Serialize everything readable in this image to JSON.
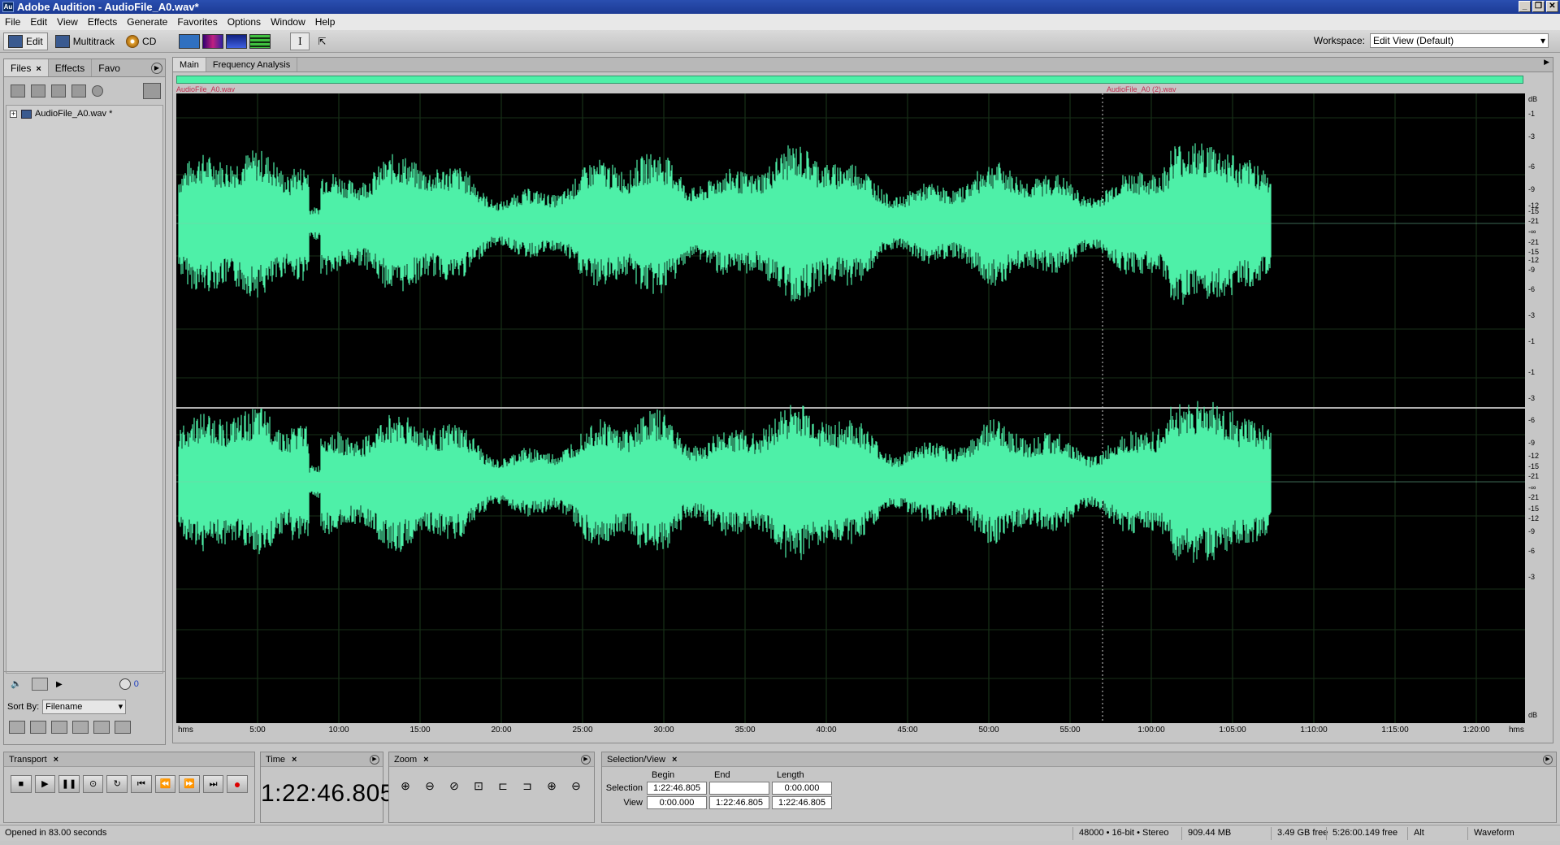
{
  "window": {
    "title": "Adobe Audition - AudioFile_A0.wav*",
    "app_icon": "Au"
  },
  "menu": [
    "File",
    "Edit",
    "View",
    "Effects",
    "Generate",
    "Favorites",
    "Options",
    "Window",
    "Help"
  ],
  "toolbar": {
    "edit_label": "Edit",
    "multitrack_label": "Multitrack",
    "cd_label": "CD",
    "workspace_label": "Workspace:",
    "workspace_value": "Edit View (Default)"
  },
  "left_panel": {
    "tabs": [
      "Files",
      "Effects",
      "Favo"
    ],
    "files": [
      "AudioFile_A0.wav *"
    ],
    "sort_by_label": "Sort By:",
    "sort_by_value": "Filename",
    "counter": "0"
  },
  "main_panel": {
    "tabs": [
      "Main",
      "Frequency Analysis"
    ],
    "marker_left": "AudioFile_A0.wav",
    "marker_right": "AudioFile_A0 (2).wav",
    "db_unit": "dB",
    "db_labels_top": [
      "-1",
      "-3",
      "-6",
      "-9",
      "-12",
      "-15",
      "-21",
      "-∞",
      "-21",
      "-15",
      "-12",
      "-9",
      "-6",
      "-3",
      "-1"
    ],
    "db_labels_bottom": [
      "-1",
      "-3",
      "-6",
      "-9",
      "-12",
      "-15",
      "-21",
      "-∞",
      "-21",
      "-15",
      "-12",
      "-9",
      "-6",
      "-3"
    ],
    "db_end": "dB",
    "ruler_start": "hms",
    "ruler_end": "hms",
    "ruler_ticks": [
      "5:00",
      "10:00",
      "15:00",
      "20:00",
      "25:00",
      "30:00",
      "35:00",
      "40:00",
      "45:00",
      "50:00",
      "55:00",
      "1:00:00",
      "1:05:00",
      "1:10:00",
      "1:15:00",
      "1:20:00"
    ],
    "waveform_color": "#4ef0a8"
  },
  "transport": {
    "title": "Transport"
  },
  "time": {
    "title": "Time",
    "value": "1:22:46.805"
  },
  "zoom": {
    "title": "Zoom"
  },
  "selection_view": {
    "title": "Selection/View",
    "col_begin": "Begin",
    "col_end": "End",
    "col_length": "Length",
    "row_selection": "Selection",
    "row_view": "View",
    "sel_begin": "1:22:46.805",
    "sel_end": "",
    "sel_length": "0:00.000",
    "view_begin": "0:00.000",
    "view_end": "1:22:46.805",
    "view_length": "1:22:46.805"
  },
  "status": {
    "message": "Opened in 83.00 seconds",
    "format": "48000 • 16-bit • Stereo",
    "file_size": "909.44 MB",
    "disk_free": "3.49 GB free",
    "time_free": "5:26:00.149 free",
    "mode": "Alt",
    "view": "Waveform"
  }
}
